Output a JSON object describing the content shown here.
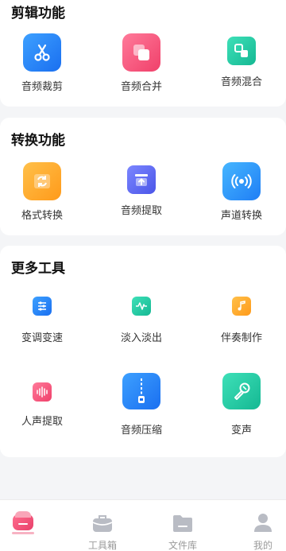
{
  "sections": {
    "edit": {
      "title": "剪辑功能",
      "tools": [
        {
          "label": "音频裁剪",
          "icon": "scissors-icon"
        },
        {
          "label": "音频合并",
          "icon": "merge-squares-icon"
        },
        {
          "label": "音频混合",
          "icon": "mix-squares-icon"
        }
      ]
    },
    "convert": {
      "title": "转换功能",
      "tools": [
        {
          "label": "格式转换",
          "icon": "format-convert-icon"
        },
        {
          "label": "音频提取",
          "icon": "extract-upload-icon"
        },
        {
          "label": "声道转换",
          "icon": "channel-broadcast-icon"
        }
      ]
    },
    "more": {
      "title": "更多工具",
      "tools": [
        {
          "label": "变调变速",
          "icon": "sliders-icon"
        },
        {
          "label": "淡入淡出",
          "icon": "fade-wave-icon"
        },
        {
          "label": "伴奏制作",
          "icon": "music-note-icon"
        },
        {
          "label": "人声提取",
          "icon": "voice-wave-icon"
        },
        {
          "label": "音频压缩",
          "icon": "zip-compress-icon"
        },
        {
          "label": "变声",
          "icon": "microphone-icon"
        }
      ]
    }
  },
  "bottom_nav": [
    {
      "label": "",
      "icon": "home-icon",
      "active": true
    },
    {
      "label": "工具箱",
      "icon": "toolbox-icon",
      "active": false
    },
    {
      "label": "文件库",
      "icon": "folder-icon",
      "active": false
    },
    {
      "label": "我的",
      "icon": "user-icon",
      "active": false
    }
  ],
  "colors": {
    "accent": "#e8406a",
    "nav_inactive": "#b9bcc4",
    "background": "#f4f5f7"
  }
}
